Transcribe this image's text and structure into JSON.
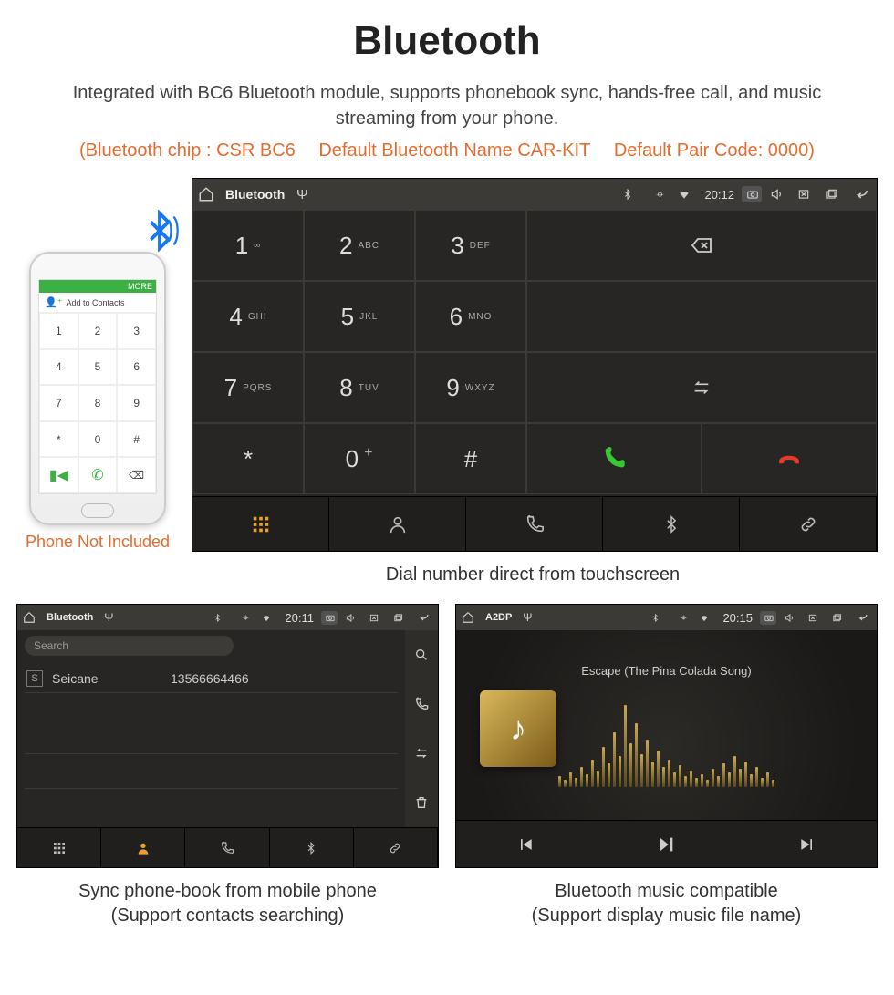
{
  "title": "Bluetooth",
  "description": "Integrated with BC6 Bluetooth module, supports phonebook sync, hands-free call, and music streaming from your phone.",
  "spec": {
    "chip": "(Bluetooth chip : CSR BC6",
    "name": "Default Bluetooth Name CAR-KIT",
    "pair": "Default Pair Code: 0000)"
  },
  "phone": {
    "caption": "Phone Not Included",
    "add_contacts": "Add to Contacts",
    "more": "MORE"
  },
  "dialer": {
    "status_label": "Bluetooth",
    "time": "20:12",
    "keys": [
      {
        "n": "1",
        "s": "∞"
      },
      {
        "n": "2",
        "s": "ABC"
      },
      {
        "n": "3",
        "s": "DEF"
      },
      {
        "n": "4",
        "s": "GHI"
      },
      {
        "n": "5",
        "s": "JKL"
      },
      {
        "n": "6",
        "s": "MNO"
      },
      {
        "n": "7",
        "s": "PQRS"
      },
      {
        "n": "8",
        "s": "TUV"
      },
      {
        "n": "9",
        "s": "WXYZ"
      },
      {
        "n": "*",
        "s": ""
      },
      {
        "n": "0",
        "s": "+"
      },
      {
        "n": "#",
        "s": ""
      }
    ],
    "caption": "Dial number direct from touchscreen"
  },
  "phonebook": {
    "status_label": "Bluetooth",
    "time": "20:11",
    "search_placeholder": "Search",
    "contact_badge": "S",
    "contact_name": "Seicane",
    "contact_number": "13566664466",
    "caption_line1": "Sync phone-book from mobile phone",
    "caption_line2": "(Support contacts searching)"
  },
  "a2dp": {
    "status_label": "A2DP",
    "time": "20:15",
    "track": "Escape (The Pina Colada Song)",
    "caption_line1": "Bluetooth music compatible",
    "caption_line2": "(Support display music file name)"
  }
}
